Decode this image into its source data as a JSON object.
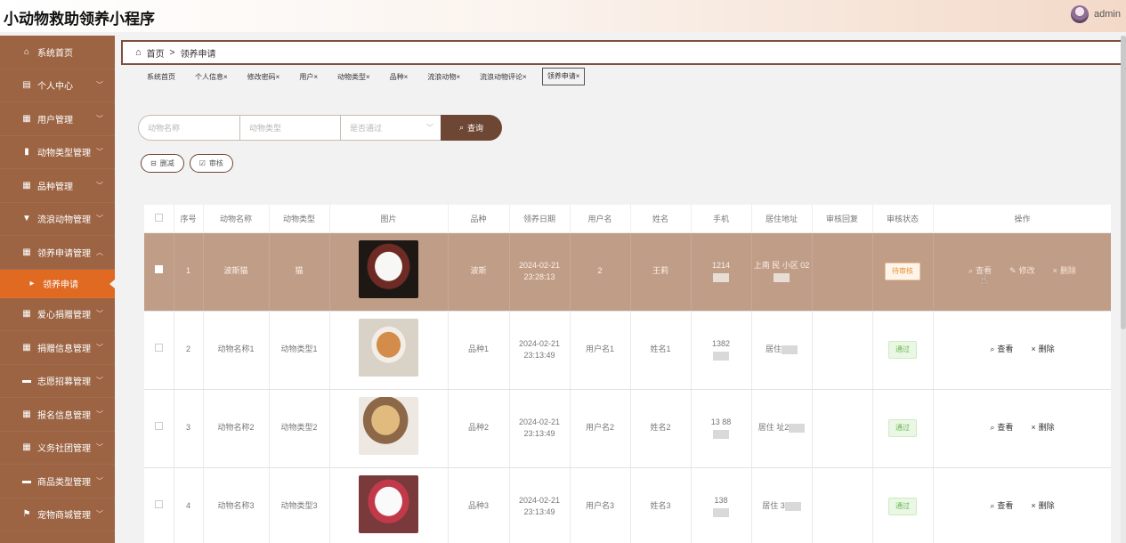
{
  "header": {
    "title": "小动物救助领养小程序",
    "username": "admin"
  },
  "sidebar": {
    "items": [
      {
        "label": "系统首页",
        "icon": "home-icon",
        "glyph": "⌂",
        "chevron": ""
      },
      {
        "label": "个人中心",
        "icon": "card-icon",
        "glyph": "▤",
        "chevron": "﹀"
      },
      {
        "label": "用户管理",
        "icon": "grid-icon",
        "glyph": "▦",
        "chevron": "﹀"
      },
      {
        "label": "动物类型管理",
        "icon": "bar-chart-icon",
        "glyph": "▮",
        "chevron": "﹀"
      },
      {
        "label": "品种管理",
        "icon": "grid-icon",
        "glyph": "▦",
        "chevron": "﹀"
      },
      {
        "label": "流浪动物管理",
        "icon": "cup-icon",
        "glyph": "▼",
        "chevron": "﹀"
      },
      {
        "label": "领养申请管理",
        "icon": "grid-icon",
        "glyph": "▦",
        "chevron": "︿"
      },
      {
        "label": "领养申请",
        "icon": "caret-right-icon",
        "glyph": "▸",
        "chevron": ""
      },
      {
        "label": "爱心捐赠管理",
        "icon": "grid-icon",
        "glyph": "▦",
        "chevron": "﹀"
      },
      {
        "label": "捐赠信息管理",
        "icon": "table-icon",
        "glyph": "▦",
        "chevron": "﹀"
      },
      {
        "label": "志愿招募管理",
        "icon": "folder-icon",
        "glyph": "▬",
        "chevron": "﹀"
      },
      {
        "label": "报名信息管理",
        "icon": "grid-icon",
        "glyph": "▦",
        "chevron": "﹀"
      },
      {
        "label": "义务社团管理",
        "icon": "grid-icon",
        "glyph": "▦",
        "chevron": "﹀"
      },
      {
        "label": "商品类型管理",
        "icon": "monitor-icon",
        "glyph": "▬",
        "chevron": "﹀"
      },
      {
        "label": "宠物商城管理",
        "icon": "flag-icon",
        "glyph": "⚑",
        "chevron": "﹀"
      }
    ]
  },
  "breadcrumb": {
    "home": "首页",
    "separator": ">",
    "current": "领养申请"
  },
  "tabs": [
    "系统首页",
    "个人信息×",
    "修改密码×",
    "用户×",
    "动物类型×",
    "品种×",
    "流浪动物×",
    "流浪动物评论×",
    "领养申请×"
  ],
  "search": {
    "name_placeholder": "动物名称",
    "type_placeholder": "动物类型",
    "status_placeholder": "是否通过",
    "query_label": "查询"
  },
  "actions": {
    "delete_label": "删减",
    "review_label": "审核"
  },
  "table": {
    "columns": [
      "序号",
      "动物名称",
      "动物类型",
      "图片",
      "品种",
      "领养日期",
      "用户名",
      "姓名",
      "手机",
      "居住地址",
      "审核回复",
      "审核状态",
      "操作"
    ],
    "rows": [
      {
        "index": "1",
        "name": "波斯猫",
        "type": "猫",
        "photo": "cat",
        "breed": "波斯",
        "date": "2024-02-21",
        "time": "23:28:13",
        "username": "2",
        "realname": "王莉",
        "phone": "1214",
        "address": "上南  民 小区  02",
        "reply": "",
        "status": "待审核",
        "status_kind": "pending",
        "ops": [
          "查看",
          "修改",
          "删除"
        ]
      },
      {
        "index": "2",
        "name": "动物名称1",
        "type": "动物类型1",
        "photo": "dog1",
        "breed": "品种1",
        "date": "2024-02-21",
        "time": "23:13:49",
        "username": "用户名1",
        "realname": "姓名1",
        "phone": "1382",
        "address": "居住",
        "reply": "",
        "status": "通过",
        "status_kind": "pass",
        "ops": [
          "查看",
          "删除"
        ]
      },
      {
        "index": "3",
        "name": "动物名称2",
        "type": "动物类型2",
        "photo": "dog2",
        "breed": "品种2",
        "date": "2024-02-21",
        "time": "23:13:49",
        "username": "用户名2",
        "realname": "姓名2",
        "phone": "13 88",
        "address": "居住 址2",
        "reply": "",
        "status": "通过",
        "status_kind": "pass",
        "ops": [
          "查看",
          "删除"
        ]
      },
      {
        "index": "4",
        "name": "动物名称3",
        "type": "动物类型3",
        "photo": "dog3",
        "breed": "品种3",
        "date": "2024-02-21",
        "time": "23:13:49",
        "username": "用户名3",
        "realname": "姓名3",
        "phone": "138",
        "address": "居住 3",
        "reply": "",
        "status": "通过",
        "status_kind": "pass",
        "ops": [
          "查看",
          "删除"
        ]
      }
    ]
  }
}
